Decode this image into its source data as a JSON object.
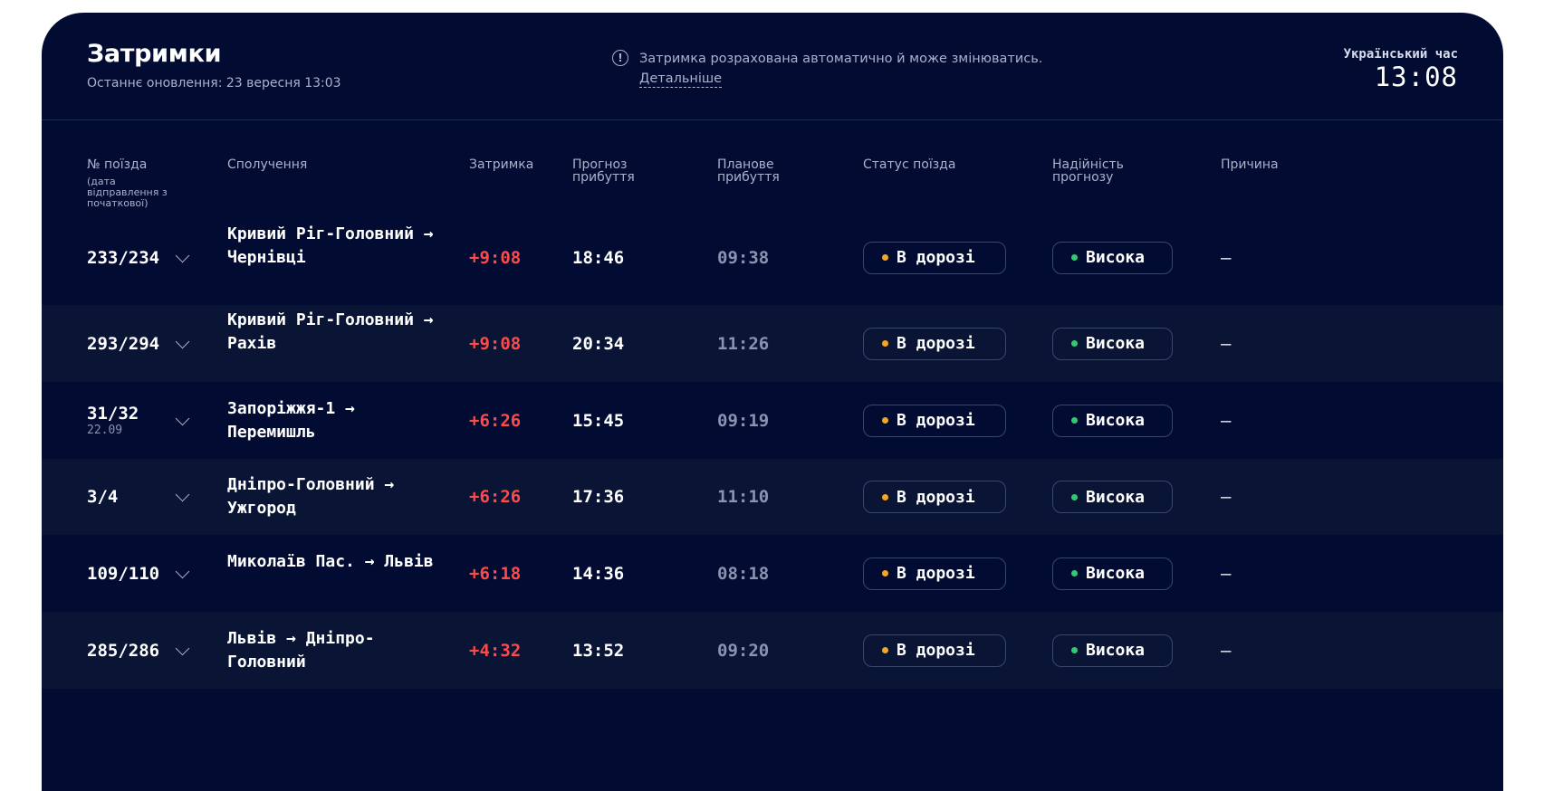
{
  "header": {
    "title": "Затримки",
    "updated": "Останнє оновлення: 23 вересня 13:03",
    "notice": "Затримка розрахована автоматично й може змінюватись.",
    "notice_link": "Детальніше",
    "notice_icon": "info-icon",
    "clock_label": "Український час",
    "clock_time": "13:08"
  },
  "columns": {
    "num": "№ поїзда",
    "num_sub": "(дата відправлення з початкової)",
    "route": "Сполучення",
    "delay": "Затримка",
    "forecast": "Прогноз прибуття",
    "planned": "Планове прибуття",
    "status": "Статус поїзда",
    "reliability": "Надійність прогнозу",
    "reason": "Причина"
  },
  "colors": {
    "background": "#020c33",
    "row_alt": "#0a1535",
    "delay": "#ff4a4a",
    "status_dot": "#f5a623",
    "reliability_dot": "#2ecc71"
  },
  "rows": [
    {
      "num": "233/234",
      "date": "",
      "route": "Кривий Ріг-Головний → Чернівці",
      "delay": "+9:08",
      "forecast": "18:46",
      "planned": "09:38",
      "status": "В дорозі",
      "reliability": "Висока",
      "reason": "—"
    },
    {
      "num": "293/294",
      "date": "",
      "route": "Кривий Ріг-Головний →  Рахів",
      "delay": "+9:08",
      "forecast": "20:34",
      "planned": "11:26",
      "status": "В дорозі",
      "reliability": "Висока",
      "reason": "—"
    },
    {
      "num": "31/32",
      "date": "22.09",
      "route": "Запоріжжя-1 → Перемишль",
      "delay": "+6:26",
      "forecast": "15:45",
      "planned": "09:19",
      "status": "В дорозі",
      "reliability": "Висока",
      "reason": "—"
    },
    {
      "num": "3/4",
      "date": "",
      "route": "Дніпро-Головний → Ужгород",
      "delay": "+6:26",
      "forecast": "17:36",
      "planned": "11:10",
      "status": "В дорозі",
      "reliability": "Висока",
      "reason": "—"
    },
    {
      "num": "109/110",
      "date": "",
      "route": "Миколаїв Пас. → Львів",
      "delay": "+6:18",
      "forecast": "14:36",
      "planned": "08:18",
      "status": "В дорозі",
      "reliability": "Висока",
      "reason": "—"
    },
    {
      "num": "285/286",
      "date": "",
      "route": "Львів →  Дніпро-Головний",
      "delay": "+4:32",
      "forecast": "13:52",
      "planned": "09:20",
      "status": "В дорозі",
      "reliability": "Висока",
      "reason": "—"
    }
  ]
}
